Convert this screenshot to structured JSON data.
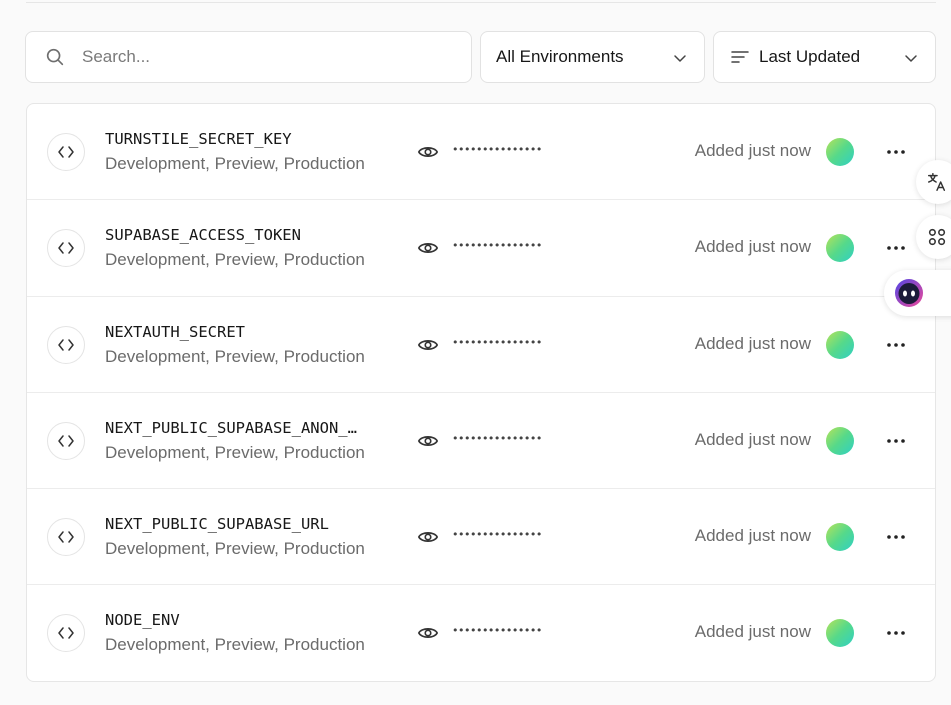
{
  "search": {
    "placeholder": "Search..."
  },
  "filters": {
    "environment_label": "All Environments",
    "sort_label": "Last Updated"
  },
  "masked_value": "•••••••••••••••",
  "rows": [
    {
      "name": "TURNSTILE_SECRET_KEY",
      "environments": "Development, Preview, Production",
      "added": "Added just now"
    },
    {
      "name": "SUPABASE_ACCESS_TOKEN",
      "environments": "Development, Preview, Production",
      "added": "Added just now"
    },
    {
      "name": "NEXTAUTH_SECRET",
      "environments": "Development, Preview, Production",
      "added": "Added just now"
    },
    {
      "name": "NEXT_PUBLIC_SUPABASE_ANON_…",
      "environments": "Development, Preview, Production",
      "added": "Added just now"
    },
    {
      "name": "NEXT_PUBLIC_SUPABASE_URL",
      "environments": "Development, Preview, Production",
      "added": "Added just now"
    },
    {
      "name": "NODE_ENV",
      "environments": "Development, Preview, Production",
      "added": "Added just now"
    }
  ],
  "icons": {
    "search": "search-icon",
    "chevron": "chevron-down-icon",
    "sort": "sort-lines-icon",
    "code": "code-icon",
    "eye": "eye-icon",
    "more": "more-horizontal-icon",
    "translate": "translate-icon",
    "command": "command-icon",
    "assistant": "assistant-face-icon"
  },
  "colors": {
    "avatar_gradient": [
      "#b6e35a",
      "#56d98a",
      "#2fd0c4"
    ],
    "assistant_accent": [
      "#4f46e5",
      "#ec4899"
    ]
  }
}
